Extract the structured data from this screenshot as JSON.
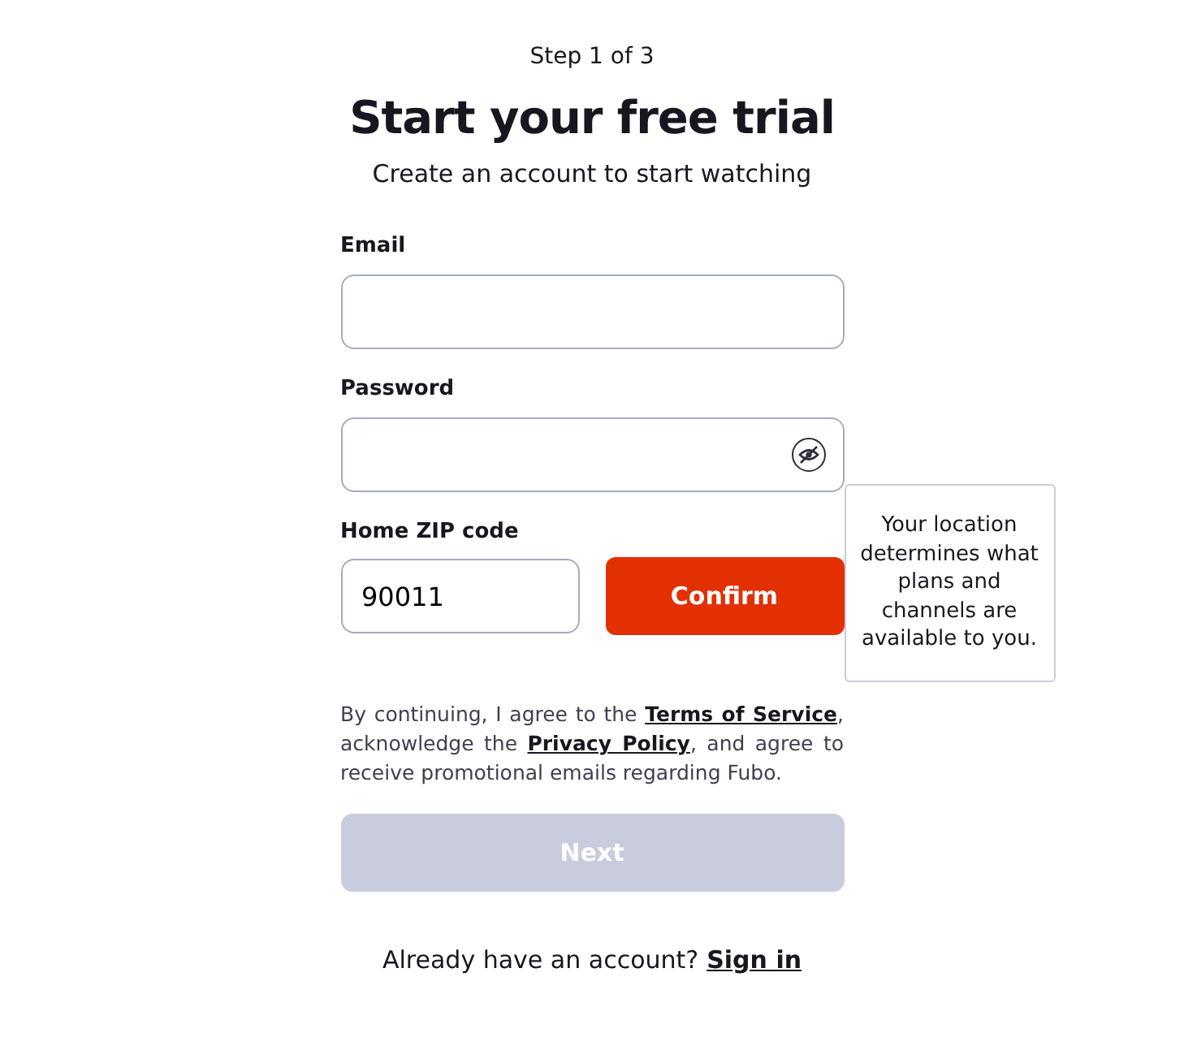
{
  "step": "Step 1 of 3",
  "title": "Start your free trial",
  "subtitle": "Create an account to start watching",
  "email": {
    "label": "Email"
  },
  "password": {
    "label": "Password",
    "visible": false
  },
  "zip": {
    "label": "Home ZIP code",
    "value": "90011",
    "button": "Confirm"
  },
  "tooltip": "Your location determines what plans and channels are available to you.",
  "consent": {
    "before": "By continuing, I agree to the ",
    "terms_link": "Terms of Service",
    "middle": ", acknowledge the ",
    "privacy_link": "Privacy Policy",
    "after": ", and agree to receive promotional emails regarding Fubo."
  },
  "next_button": {
    "label": "Next",
    "disabled": true
  },
  "signin": {
    "prompt": "Already have an account?",
    "link": "Sign in"
  }
}
